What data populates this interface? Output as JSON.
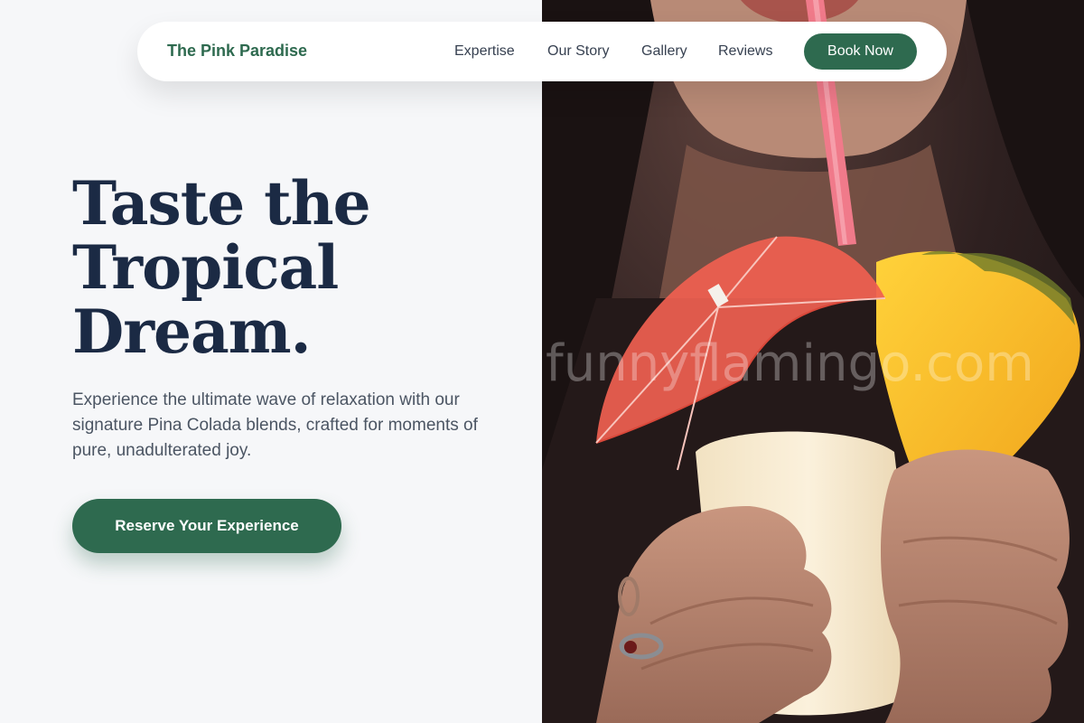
{
  "nav": {
    "brand": "The Pink Paradise",
    "links": [
      "Expertise",
      "Our Story",
      "Gallery",
      "Reviews"
    ],
    "cta": "Book Now"
  },
  "hero": {
    "headline": [
      "Taste the",
      "Tropical",
      "Dream."
    ],
    "subtext": "Experience the ultimate wave of relaxation with our signature Pina Colada blends, crafted for moments of pure, unadulterated joy.",
    "cta": "Reserve Your Experience"
  },
  "photo": {
    "watermark": "funnyflamingo.com"
  },
  "colors": {
    "brand_green": "#2e6a4f",
    "headline_navy": "#1b2a44",
    "background": "#f6f7f9"
  }
}
